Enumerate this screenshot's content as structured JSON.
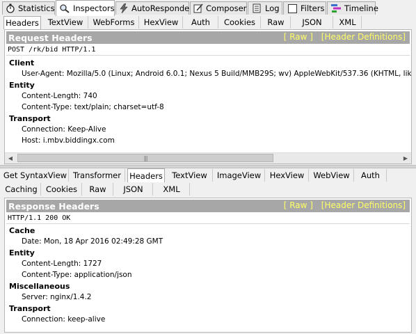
{
  "main_tabs": [
    {
      "label": "Statistics",
      "icon": "stopwatch-icon"
    },
    {
      "label": "Inspectors",
      "icon": "inspect-icon"
    },
    {
      "label": "AutoResponder",
      "icon": "lightning-icon"
    },
    {
      "label": "Composer",
      "icon": "compose-icon"
    },
    {
      "label": "Log",
      "icon": "log-icon"
    },
    {
      "label": "Filters",
      "icon": "checkbox-icon"
    },
    {
      "label": "Timeline",
      "icon": "timeline-icon"
    }
  ],
  "request": {
    "tabs": [
      "Headers",
      "TextView",
      "WebForms",
      "HexView",
      "Auth",
      "Cookies",
      "Raw",
      "JSON",
      "XML"
    ],
    "active_tab": "Headers",
    "title": "Request Headers",
    "raw_link": "[ Raw ]",
    "defs_link": "[Header Definitions]",
    "request_line": "POST /rk/bid HTTP/1.1",
    "groups": [
      {
        "name": "Client",
        "items": [
          "User-Agent: Mozilla/5.0 (Linux; Android 6.0.1; Nexus 5 Build/MMB29S; wv) AppleWebKit/537.36 (KHTML, like Gecko)"
        ]
      },
      {
        "name": "Entity",
        "items": [
          "Content-Length: 740",
          "Content-Type: text/plain; charset=utf-8"
        ]
      },
      {
        "name": "Transport",
        "items": [
          "Connection: Keep-Alive",
          "Host: i.mbv.biddingx.com"
        ]
      }
    ]
  },
  "response": {
    "tabs_row1": [
      "Get SyntaxView",
      "Transformer",
      "Headers",
      "TextView",
      "ImageView",
      "HexView",
      "WebView",
      "Auth"
    ],
    "tabs_row2": [
      "Caching",
      "Cookies",
      "Raw",
      "JSON",
      "XML"
    ],
    "active_tab": "Headers",
    "title": "Response Headers",
    "raw_link": "[ Raw ]",
    "defs_link": "[Header Definitions]",
    "status_line": "HTTP/1.1 200 OK",
    "groups": [
      {
        "name": "Cache",
        "items": [
          "Date: Mon, 18 Apr 2016 02:49:28 GMT"
        ]
      },
      {
        "name": "Entity",
        "items": [
          "Content-Length: 1727",
          "Content-Type: application/json"
        ]
      },
      {
        "name": "Miscellaneous",
        "items": [
          "Server: nginx/1.4.2"
        ]
      },
      {
        "name": "Transport",
        "items": [
          "Connection: keep-alive"
        ]
      }
    ]
  }
}
